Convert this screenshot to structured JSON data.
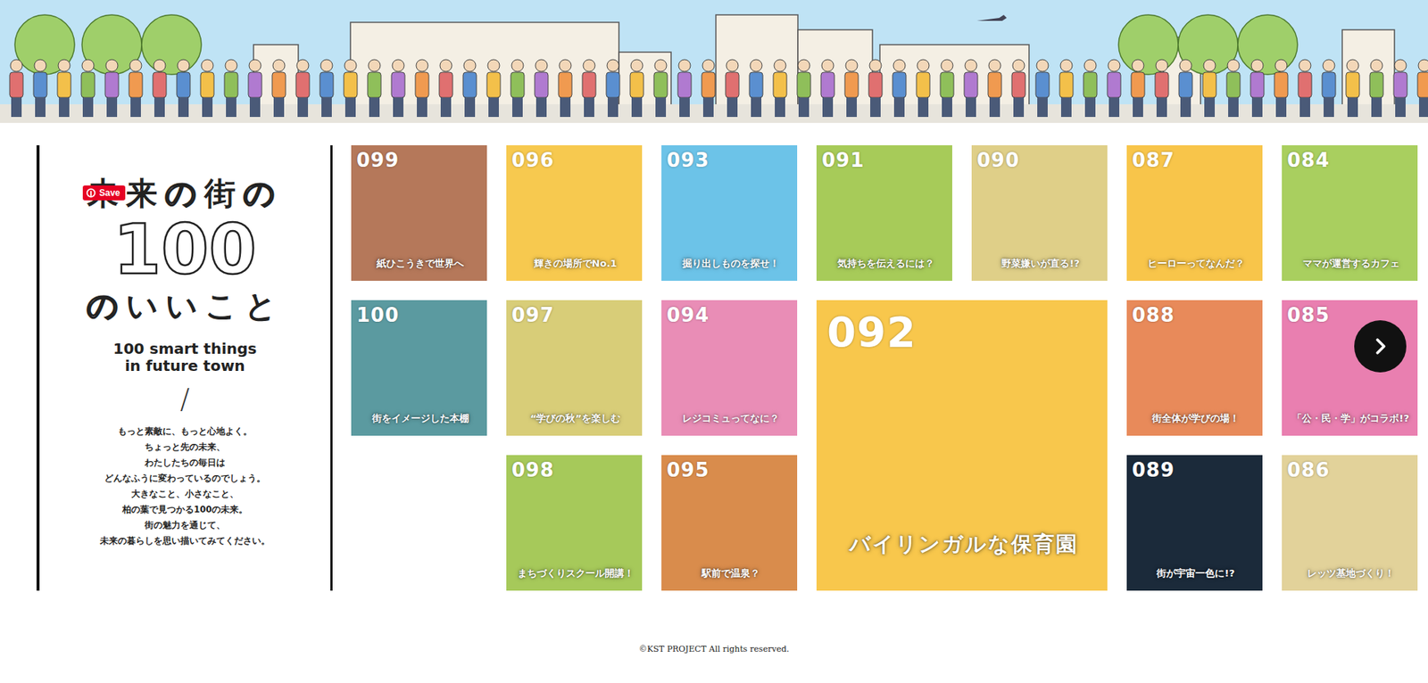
{
  "pin_button": {
    "label": "Save"
  },
  "intro": {
    "title_top": [
      {
        "text": "未来",
        "outlined": false
      },
      {
        "text": "の",
        "outlined": true
      },
      {
        "text": "街",
        "outlined": false
      },
      {
        "text": "の",
        "outlined": true
      }
    ],
    "title_number": "100",
    "title_bottom": [
      {
        "text": "の",
        "outlined": true
      },
      {
        "text": "いいこと",
        "outlined": false
      }
    ],
    "subtitle_lines": [
      "100 smart things",
      "in future town"
    ],
    "divider": "/",
    "body_lines": [
      "もっと素敵に、もっと心地よく。",
      "ちょっと先の未来、",
      "わたしたちの毎日は",
      "どんなふうに変わっているのでしょう。",
      "大きなこと、小さなこと、",
      "柏の葉で見つかる100の未来。",
      "街の魅力を通じて、",
      "未来の暮らしを思い描いてみてください。"
    ]
  },
  "tiles": [
    {
      "number": "099",
      "caption": "紙ひこうきで世界へ",
      "color": "#b5785a",
      "kind": "small"
    },
    {
      "number": "096",
      "caption": "輝きの場所でNo.1",
      "color": "#f7c94f",
      "kind": "small"
    },
    {
      "number": "093",
      "caption": "掘り出しものを探せ！",
      "color": "#6cc3e8",
      "kind": "small"
    },
    {
      "number": "091",
      "caption": "気持ちを伝えるには？",
      "color": "#a7cb59",
      "kind": "small"
    },
    {
      "number": "090",
      "caption": "野菜嫌いが直る!?",
      "color": "#dfcf88",
      "kind": "small"
    },
    {
      "number": "087",
      "caption": "ヒーローってなんだ？",
      "color": "#f8c54a",
      "kind": "small"
    },
    {
      "number": "084",
      "caption": "ママが運営するカフェ",
      "color": "#a9cf5f",
      "kind": "small"
    },
    {
      "number": "100",
      "caption": "街をイメージした本棚",
      "color": "#5b9aa0",
      "kind": "small"
    },
    {
      "number": "097",
      "caption": "“学びの秋”を楽しむ",
      "color": "#d8cd78",
      "kind": "small"
    },
    {
      "number": "094",
      "caption": "レジコミュってなに？",
      "color": "#e98db6",
      "kind": "small"
    },
    {
      "number": "092",
      "caption": "バイリンガルな保育園",
      "color": "#f8c74c",
      "kind": "large"
    },
    {
      "number": "088",
      "caption": "街全体が学びの場！",
      "color": "#e88a5a",
      "kind": "small"
    },
    {
      "number": "085",
      "caption": "「公・民・学」がコラボ!?",
      "color": "#e97fb0",
      "kind": "small"
    },
    {
      "number": "098",
      "caption": "まちづくりスクール開講！",
      "color": "#a6c95a",
      "kind": "small"
    },
    {
      "number": "095",
      "caption": "駅前で温泉？",
      "color": "#d98c4c",
      "kind": "small"
    },
    {
      "number": "089",
      "caption": "街が宇宙一色に!?",
      "color": "#1b2a3a",
      "kind": "small"
    },
    {
      "number": "086",
      "caption": "レッツ基地づくり！",
      "color": "#e2d29a",
      "kind": "small"
    }
  ],
  "footer": "©KST PROJECT All rights reserved."
}
